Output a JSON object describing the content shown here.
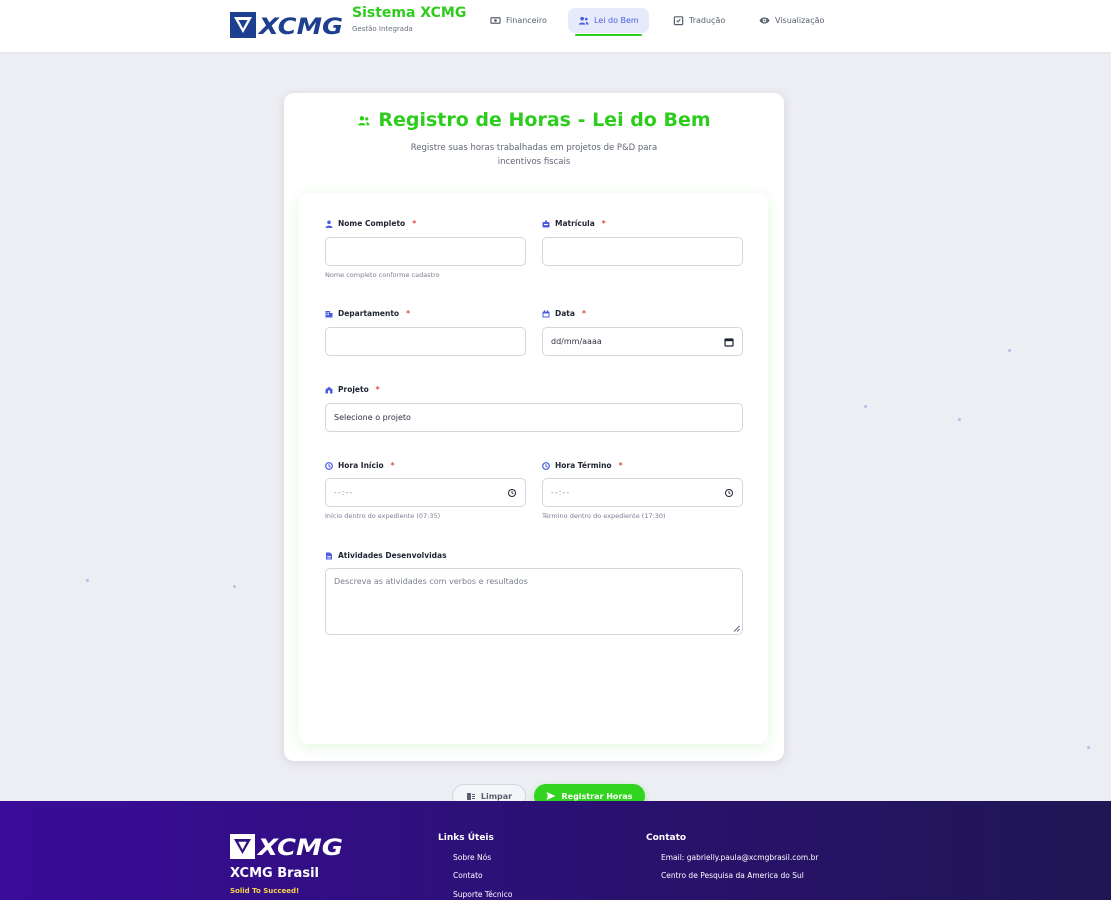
{
  "header": {
    "brand_title": "Sistema XCMG",
    "brand_sub": "Gestão Integrada",
    "nav": [
      {
        "label": "Financeiro",
        "icon": "money-icon"
      },
      {
        "label": "Lei do Bem",
        "icon": "users-icon",
        "active": true
      },
      {
        "label": "Tradução",
        "icon": "translate-icon"
      },
      {
        "label": "Visualização",
        "icon": "eye-icon"
      }
    ]
  },
  "form": {
    "title": "Registro de Horas - Lei do Bem",
    "subtitle": "Registre suas horas trabalhadas em projetos de P&D para incentivos fiscais",
    "nome": {
      "label": "Nome Completo",
      "help": "Nome completo conforme cadastro"
    },
    "matricula": {
      "label": "Matrícula"
    },
    "departamento": {
      "label": "Departamento"
    },
    "data": {
      "label": "Data",
      "placeholder": "dd/mm/aaaa"
    },
    "projeto": {
      "label": "Projeto",
      "value": "Selecione o projeto"
    },
    "hora_inicio": {
      "label": "Hora Início",
      "placeholder": "--:--",
      "help": "Início dentro do expediente (07:35)"
    },
    "hora_termino": {
      "label": "Hora Término",
      "placeholder": "--:--",
      "help": "Término dentro do expediente (17:30)"
    },
    "atividades": {
      "label": "Atividades Desenvolvidas",
      "placeholder": "Descreva as atividades com verbos e resultados"
    },
    "required_mark": "*",
    "clear_label": "Limpar",
    "submit_label": "Registrar Horas"
  },
  "footer": {
    "company": "XCMG Brasil",
    "tagline": "Solid To Succeed!",
    "links_title": "Links Úteis",
    "links": [
      "Sobre Nós",
      "Contato",
      "Suporte Técnico"
    ],
    "contact_title": "Contato",
    "email": "Email: gabrielly.paula@xcmgbrasil.com.br",
    "center": "Centro de Pesquisa da America do Sul"
  },
  "colors": {
    "brand_green": "#2ecc1d",
    "accent_blue": "#4a5de0",
    "logo_blue": "#1d3f8f",
    "footer_purple": "#3a0c9a"
  }
}
